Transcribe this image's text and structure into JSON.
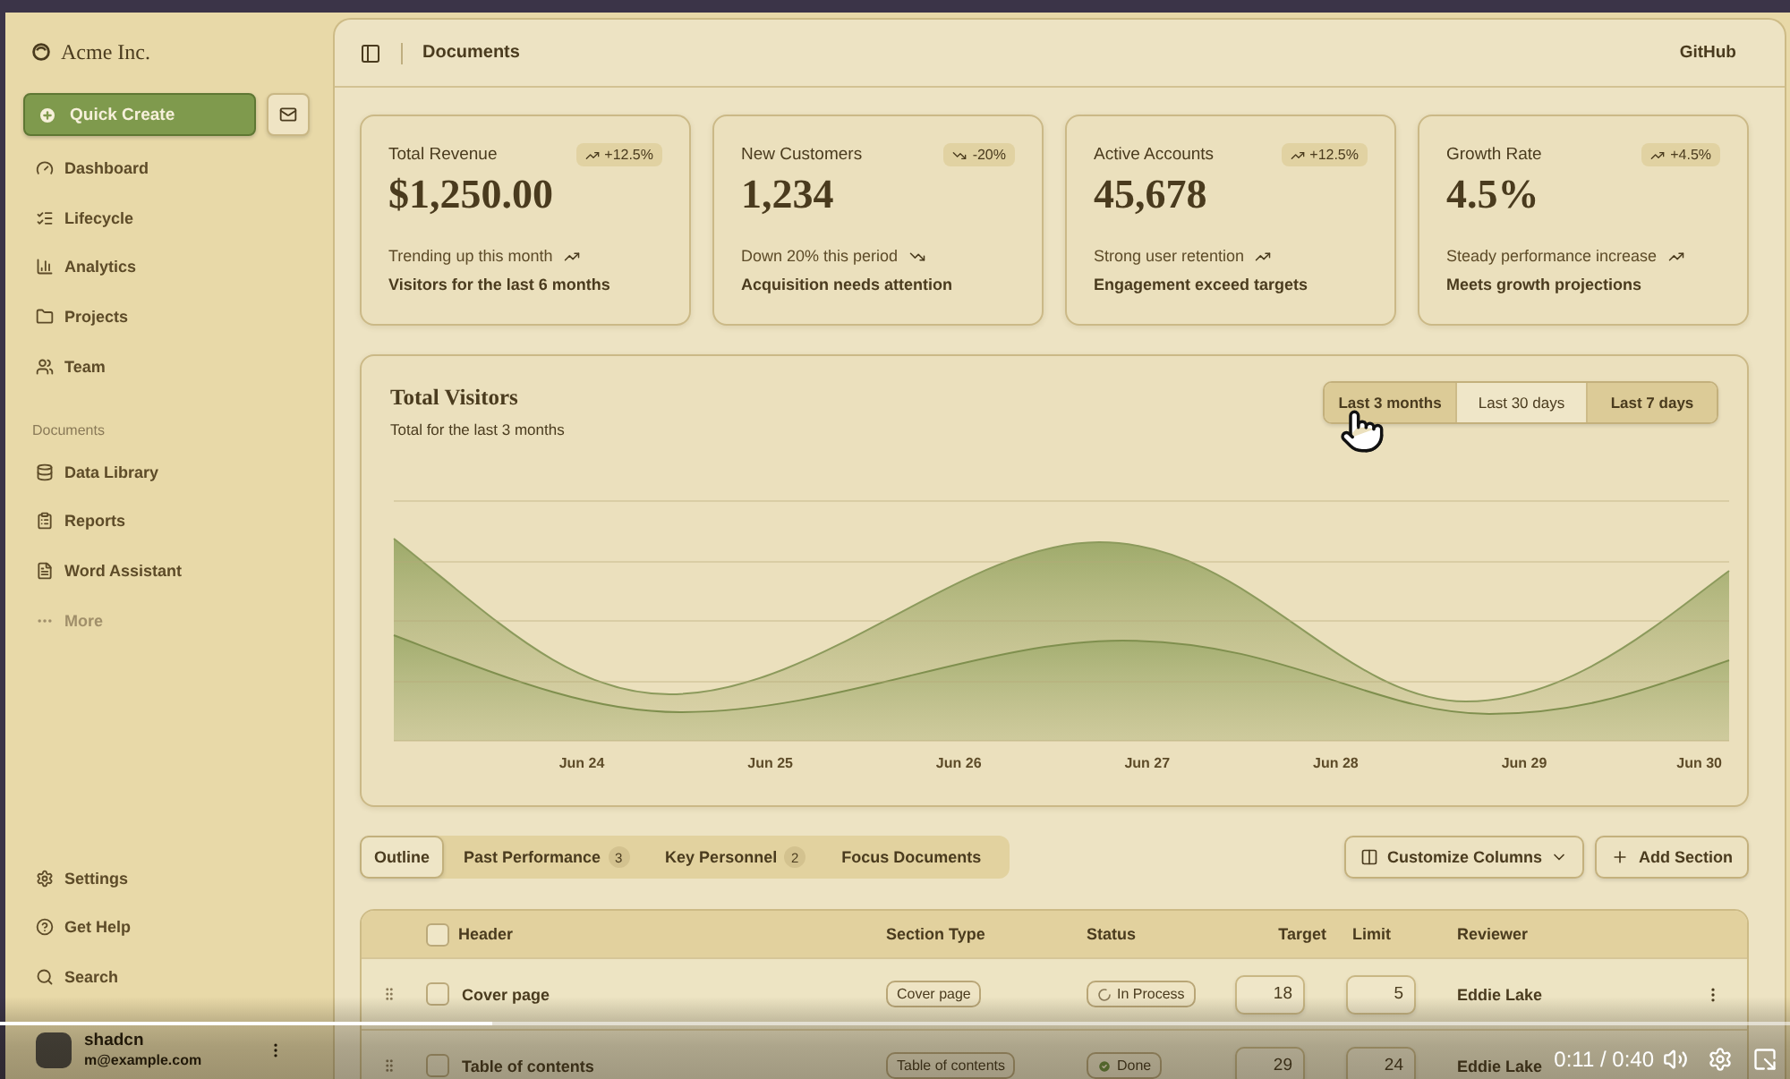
{
  "sidebar": {
    "brand": "Acme Inc.",
    "quick_create": "Quick Create",
    "main_nav": [
      "Dashboard",
      "Lifecycle",
      "Analytics",
      "Projects",
      "Team"
    ],
    "documents_label": "Documents",
    "documents_nav": [
      "Data Library",
      "Reports",
      "Word Assistant"
    ],
    "more": "More",
    "footer_nav": [
      "Settings",
      "Get Help",
      "Search"
    ],
    "user": {
      "name": "shadcn",
      "email": "m@example.com"
    }
  },
  "header": {
    "title": "Documents",
    "link": "GitHub"
  },
  "stat_cards": [
    {
      "kind": "up",
      "title": "Total Revenue",
      "badge": "+12.5%",
      "value": "$1,250.00",
      "note": "Trending up this month",
      "footnote": "Visitors for the last 6 months"
    },
    {
      "kind": "down",
      "title": "New Customers",
      "badge": "-20%",
      "value": "1,234",
      "note": "Down 20% this period",
      "footnote": "Acquisition needs attention"
    },
    {
      "kind": "up",
      "title": "Active Accounts",
      "badge": "+12.5%",
      "value": "45,678",
      "note": "Strong user retention",
      "footnote": "Engagement exceed targets"
    },
    {
      "kind": "up",
      "title": "Growth Rate",
      "badge": "+4.5%",
      "value": "4.5%",
      "note": "Steady performance increase",
      "footnote": "Meets growth projections"
    }
  ],
  "visitors_chart": {
    "title": "Total Visitors",
    "subtitle": "Total for the last 3 months",
    "ranges": [
      {
        "label": "Last 3 months",
        "selected": true
      },
      {
        "label": "Last 30 days",
        "selected": false
      },
      {
        "label": "Last 7 days",
        "selected": true
      }
    ],
    "x_labels": [
      "Jun 24",
      "Jun 25",
      "Jun 26",
      "Jun 27",
      "Jun 28",
      "Jun 29",
      "Jun 30"
    ]
  },
  "section_tabs": [
    {
      "label": "Outline",
      "selected": true
    },
    {
      "label": "Past Performance",
      "count": "3",
      "selected": false
    },
    {
      "label": "Key Personnel",
      "count": "2",
      "selected": false
    },
    {
      "label": "Focus Documents",
      "selected": false
    }
  ],
  "table_actions": [
    "Customize Columns",
    "Add Section"
  ],
  "table": {
    "columns": [
      "Header",
      "Section Type",
      "Status",
      "Target",
      "Limit",
      "Reviewer"
    ],
    "select_all": false,
    "rows": [
      {
        "checked": false,
        "header": "Cover page",
        "section_type": "Cover page",
        "status": {
          "kind": "in_process",
          "label": "In Process"
        },
        "target": "18",
        "limit": "5",
        "reviewer": "Eddie Lake"
      },
      {
        "checked": false,
        "header": "Table of contents",
        "section_type": "Table of contents",
        "status": {
          "kind": "done",
          "label": "Done"
        },
        "target": "29",
        "limit": "24",
        "reviewer": "Eddie Lake"
      }
    ]
  },
  "video_player": {
    "level": 0.275,
    "time": "0:11 / 0:40"
  }
}
